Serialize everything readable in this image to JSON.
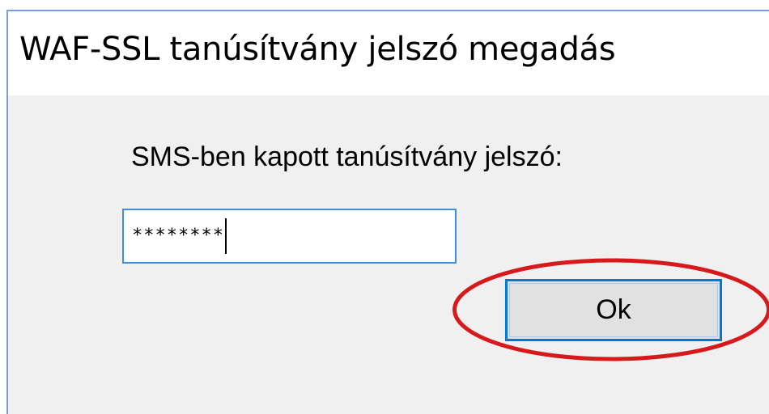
{
  "window": {
    "title": "WAF-SSL tanúsítvány jelszó megadás"
  },
  "dialog": {
    "prompt_label": "SMS-ben kapott tanúsítvány jelszó:",
    "password_value": "********",
    "ok_label": "Ok"
  },
  "annotation": {
    "shape": "ellipse",
    "color": "#d7191c",
    "target": "ok-button"
  },
  "colors": {
    "title_bg": "#ffffff",
    "client_bg": "#f0f0f0",
    "window_border": "#7a9fd8",
    "input_border_focus": "#3c8fd8",
    "button_bg": "#e1e1e1",
    "button_border_default": "#0078d7"
  }
}
